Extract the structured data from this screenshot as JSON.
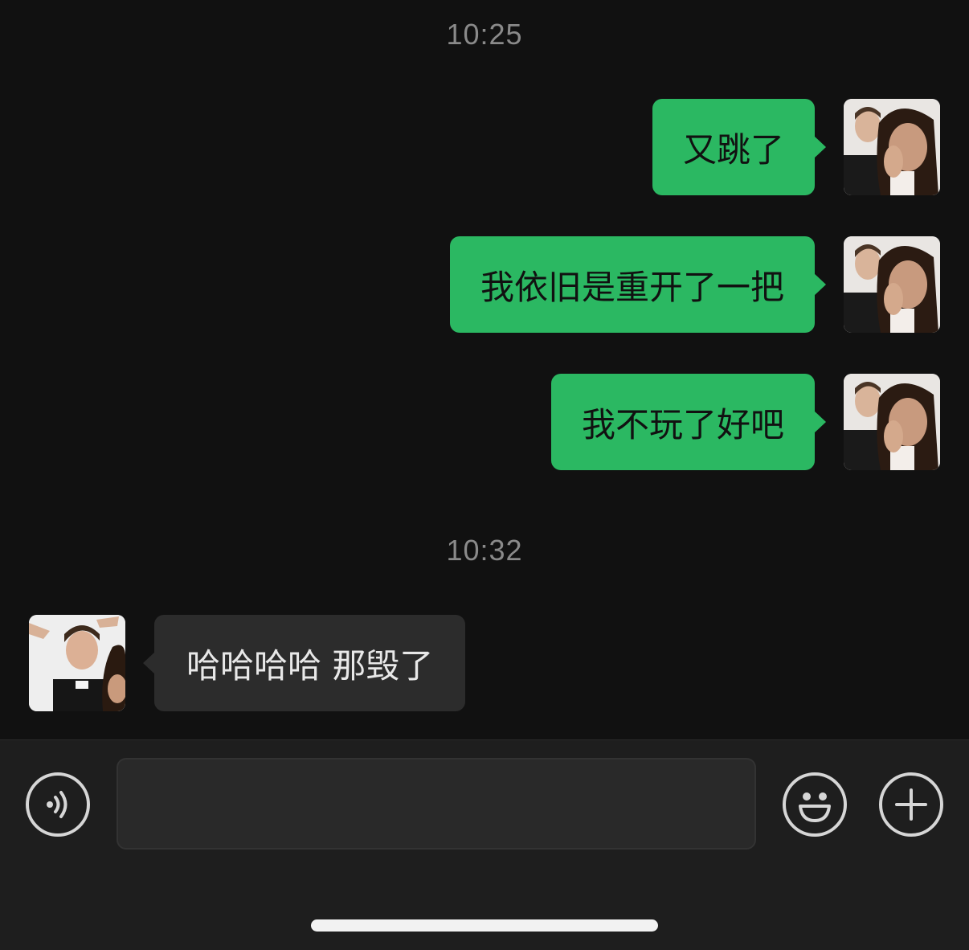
{
  "chat": {
    "timestamps": [
      "10:25",
      "10:32"
    ],
    "messages": [
      {
        "from": "me",
        "text": "又跳了"
      },
      {
        "from": "me",
        "text": "我依旧是重开了一把"
      },
      {
        "from": "me",
        "text": "我不玩了好吧"
      },
      {
        "from": "them",
        "text": "哈哈哈哈 那毁了"
      }
    ]
  },
  "input_bar": {
    "message_value": "",
    "voice_icon": "voice-icon",
    "emoji_icon": "emoji-icon",
    "plus_icon": "plus-icon"
  },
  "colors": {
    "background": "#111111",
    "my_bubble": "#2bb862",
    "their_bubble": "#2c2c2c",
    "input_bar": "#1e1e1e"
  }
}
